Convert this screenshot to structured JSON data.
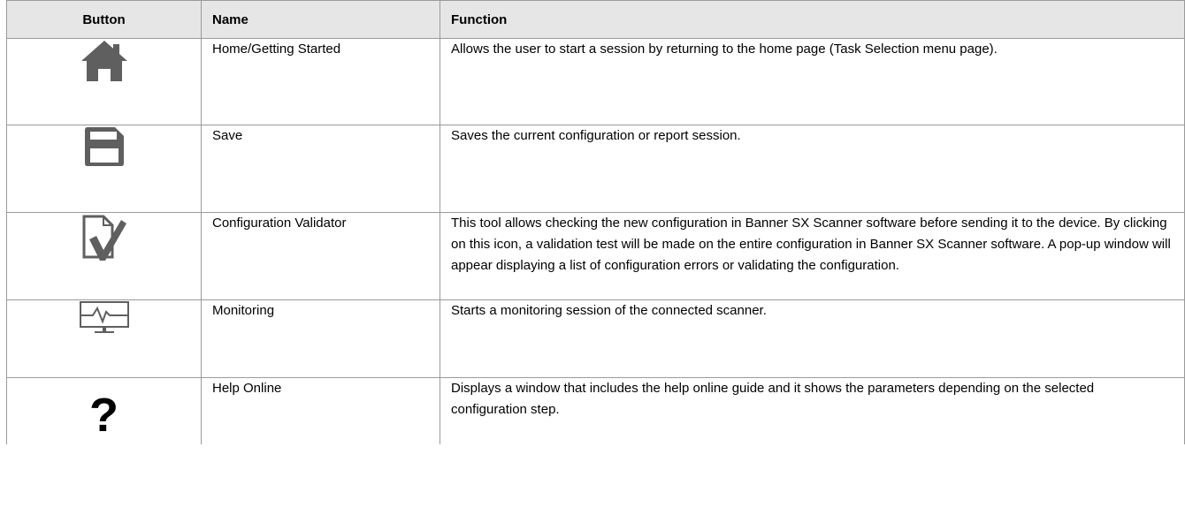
{
  "header": {
    "button": "Button",
    "name": "Name",
    "function": "Function"
  },
  "rows": [
    {
      "icon": "home-icon",
      "name": "Home/Getting Started",
      "function": "Allows the user to start a session by returning to the home page (Task Selection menu page)."
    },
    {
      "icon": "floppy-disk-save-icon",
      "name": "Save",
      "function": "Saves the current configuration or report session."
    },
    {
      "icon": "document-checkmark-icon",
      "name": "Configuration Validator",
      "function": "This tool allows checking the new configuration in Banner SX Scanner software before sending it to the device. By clicking on this icon, a validation test will be made on the entire configuration in Banner SX Scanner software. A pop-up window will appear displaying a list of configuration errors or validating the configuration."
    },
    {
      "icon": "monitor-waveform-icon",
      "name": "Monitoring",
      "function": "Starts a monitoring session of the connected scanner."
    },
    {
      "icon": "question-mark-icon",
      "icon_glyph": "?",
      "name": "Help Online",
      "function": "Displays a window that includes the help online guide and it shows the parameters depending on the selected configuration step."
    }
  ],
  "colors": {
    "icon_gray": "#5f5f5f",
    "header_bg": "#e6e6e6",
    "border": "#9a9a9a"
  }
}
